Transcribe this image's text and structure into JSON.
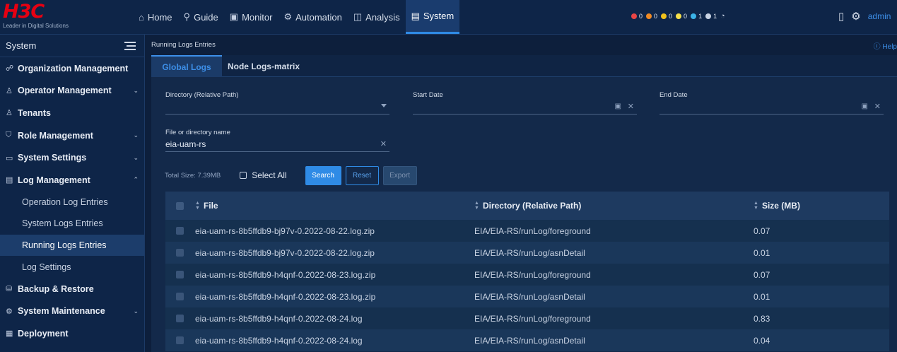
{
  "brand": {
    "logo": "H3C",
    "tagline": "Leader in Digital Solutions"
  },
  "nav": [
    {
      "label": "Home",
      "icon": "home-icon",
      "glyph": "⌂"
    },
    {
      "label": "Guide",
      "icon": "guide-icon",
      "glyph": "⚲"
    },
    {
      "label": "Monitor",
      "icon": "monitor-icon",
      "glyph": "▣"
    },
    {
      "label": "Automation",
      "icon": "automation-icon",
      "glyph": "⚙"
    },
    {
      "label": "Analysis",
      "icon": "analysis-icon",
      "glyph": "◫"
    },
    {
      "label": "System",
      "icon": "system-icon",
      "glyph": "▤"
    }
  ],
  "alarms": [
    {
      "count": "0",
      "color": "#e84545"
    },
    {
      "count": "0",
      "color": "#f08a24"
    },
    {
      "count": "0",
      "color": "#f2c21b"
    },
    {
      "count": "0",
      "color": "#f6e04b"
    },
    {
      "count": "1",
      "color": "#3bb3e8"
    },
    {
      "count": "1",
      "color": "#c9d3e3"
    }
  ],
  "user": {
    "name": "admin"
  },
  "sidebar": {
    "title": "System",
    "items": [
      {
        "label": "Organization Management",
        "icon": "organization-icon",
        "glyph": "☍",
        "chevron": ""
      },
      {
        "label": "Operator Management",
        "icon": "operator-icon",
        "glyph": "♙",
        "chevron": "⌄"
      },
      {
        "label": "Tenants",
        "icon": "tenants-icon",
        "glyph": "♙",
        "chevron": ""
      },
      {
        "label": "Role Management",
        "icon": "role-icon",
        "glyph": "⛉",
        "chevron": "⌄"
      },
      {
        "label": "System Settings",
        "icon": "settings-icon",
        "glyph": "▭",
        "chevron": "⌄"
      },
      {
        "label": "Log Management",
        "icon": "log-icon",
        "glyph": "▤",
        "chevron": "⌃"
      }
    ],
    "log_sub": [
      "Operation Log Entries",
      "System Logs Entries",
      "Running Logs Entries",
      "Log Settings"
    ],
    "bottom_items": [
      {
        "label": "Backup & Restore",
        "icon": "backup-icon",
        "glyph": "⛁",
        "chevron": ""
      },
      {
        "label": "System Maintenance",
        "icon": "maintenance-icon",
        "glyph": "⚙",
        "chevron": "⌄"
      },
      {
        "label": "Deployment",
        "icon": "deployment-icon",
        "glyph": "▦",
        "chevron": ""
      }
    ]
  },
  "breadcrumb": "Running Logs Entries",
  "help": "Help",
  "tabs": [
    "Global Logs",
    "Node Logs-matrix"
  ],
  "filters": {
    "directory_label": "Directory (Relative Path)",
    "directory_value": "",
    "start_label": "Start Date",
    "end_label": "End Date",
    "name_label": "File or directory name",
    "name_value": "eia-uam-rs"
  },
  "actions": {
    "total": "Total Size: 7.39MB",
    "select_all": "Select All",
    "search": "Search",
    "reset": "Reset",
    "export": "Export"
  },
  "table": {
    "headers": [
      "File",
      "Directory (Relative Path)",
      "Size (MB)"
    ],
    "rows": [
      [
        "eia-uam-rs-8b5ffdb9-bj97v-0.2022-08-22.log.zip",
        "EIA/EIA-RS/runLog/foreground",
        "0.07"
      ],
      [
        "eia-uam-rs-8b5ffdb9-bj97v-0.2022-08-22.log.zip",
        "EIA/EIA-RS/runLog/asnDetail",
        "0.01"
      ],
      [
        "eia-uam-rs-8b5ffdb9-h4qnf-0.2022-08-23.log.zip",
        "EIA/EIA-RS/runLog/foreground",
        "0.07"
      ],
      [
        "eia-uam-rs-8b5ffdb9-h4qnf-0.2022-08-23.log.zip",
        "EIA/EIA-RS/runLog/asnDetail",
        "0.01"
      ],
      [
        "eia-uam-rs-8b5ffdb9-h4qnf-0.2022-08-24.log",
        "EIA/EIA-RS/runLog/foreground",
        "0.83"
      ],
      [
        "eia-uam-rs-8b5ffdb9-h4qnf-0.2022-08-24.log",
        "EIA/EIA-RS/runLog/asnDetail",
        "0.04"
      ]
    ]
  }
}
